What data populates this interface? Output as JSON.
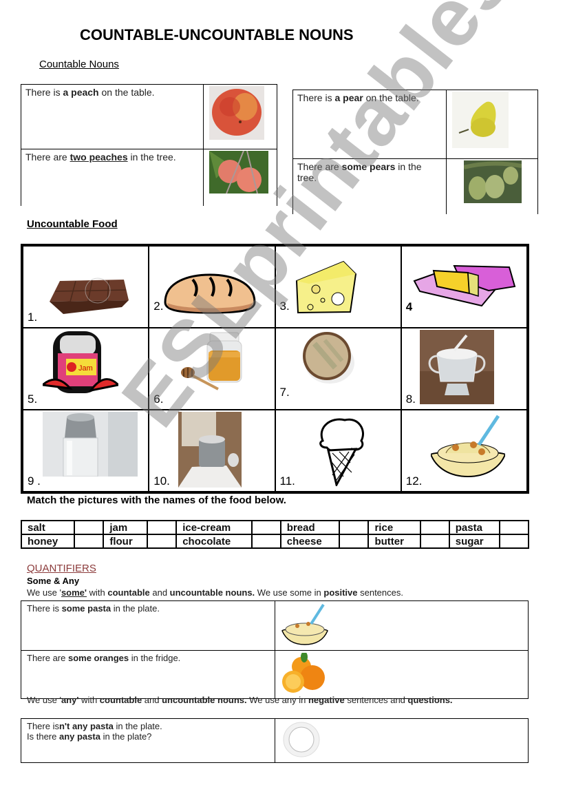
{
  "title": "COUNTABLE-UNCOUNTABLE NOUNS",
  "countable": {
    "heading": "Countable Nouns",
    "left_table": [
      {
        "pre": "There is ",
        "bold": "a peach",
        "post": " on the table.",
        "underline": false,
        "image": "peach-image"
      },
      {
        "pre": "There are ",
        "bold": "two peaches",
        "post": " in the tree.",
        "underline": true,
        "image": "peaches-in-tree-image"
      }
    ],
    "right_table": [
      {
        "pre": "There is ",
        "bold": "a pear",
        "post": " on the table.",
        "underline": false,
        "image": "pear-image"
      },
      {
        "pre": "There are ",
        "bold": "some pears",
        "post": " in the tree.",
        "underline": false,
        "image": "pears-in-tree-image"
      }
    ]
  },
  "uncountable": {
    "heading": "Uncountable Food",
    "items": [
      {
        "num": "1.",
        "image": "chocolate-bar-image"
      },
      {
        "num": "2.",
        "image": "bread-image"
      },
      {
        "num": "3.",
        "image": "cheese-image"
      },
      {
        "num": "4",
        "image": "butter-image"
      },
      {
        "num": "5.",
        "image": "jam-jar-image"
      },
      {
        "num": "6.",
        "image": "honey-jar-image"
      },
      {
        "num": "7.",
        "image": "rice-bowl-image"
      },
      {
        "num": "8.",
        "image": "sugar-bowl-image"
      },
      {
        "num": "9 .",
        "image": "salt-shaker-image"
      },
      {
        "num": "10.",
        "image": "flour-image"
      },
      {
        "num": "11.",
        "image": "ice-cream-image"
      },
      {
        "num": "12.",
        "image": "pasta-image"
      }
    ],
    "jam_label": "Jam"
  },
  "match": {
    "instruction": "Match the pictures with the names of the food below.",
    "rows": [
      [
        "salt",
        "jam",
        "ice-cream",
        "bread",
        "rice",
        "pasta"
      ],
      [
        "honey",
        "flour",
        "chocolate",
        "cheese",
        "butter",
        "sugar"
      ]
    ]
  },
  "quantifiers": {
    "heading": "QUANTIFIERS",
    "subheading": "Some & Any",
    "some_rule": {
      "t1": "We use '",
      "b1": "some'",
      "t2": " with ",
      "b2": "countable",
      "t3": " and ",
      "b3": "uncountable nouns.",
      "t4": " We use some in ",
      "b4": "positive",
      "t5": " sentences."
    },
    "some_table": [
      {
        "pre": "There is ",
        "bold": "some pasta",
        "post": " in the plate.",
        "image": "pasta-plate-image"
      },
      {
        "pre": "There are ",
        "bold": "some oranges",
        "post": " in the fridge.",
        "image": "oranges-image"
      }
    ],
    "any_rule": {
      "t1": "We use '",
      "b1": "any'",
      "t2": " with ",
      "b2": "countable",
      "t3": " and ",
      "b3": "uncountable nouns.",
      "t4": " We use any in ",
      "b4": "negative",
      "t5": " sentences and ",
      "b5": "questions."
    },
    "any_table": {
      "line1_pre": "There is",
      "line1_bold": "n't any pasta",
      "line1_post": " in the plate.",
      "line2_pre": "Is there ",
      "line2_bold": "any pasta",
      "line2_post": " in the plate?",
      "image": "empty-plate-image"
    }
  },
  "watermark": "ESLprintables.com"
}
